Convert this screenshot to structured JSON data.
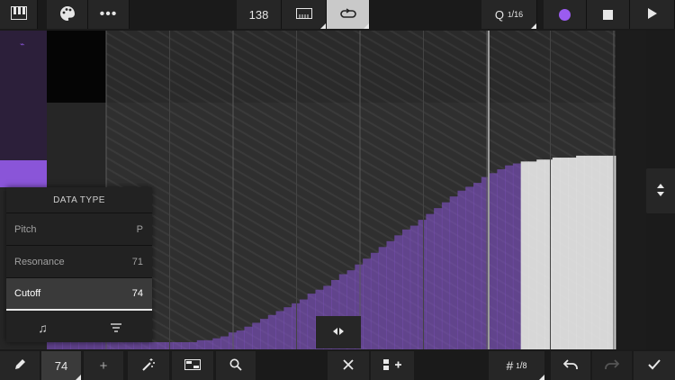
{
  "toolbar": {
    "tempo": "138",
    "quantize_q": "Q",
    "quantize_num": "1",
    "quantize_den": "16"
  },
  "colors": {
    "accent": "#8a55d8",
    "record": "#9b5cf0",
    "ghost_fill": "#e0e0e0"
  },
  "panel": {
    "title": "DATA TYPE",
    "items": [
      {
        "label": "Pitch",
        "value": "P"
      },
      {
        "label": "Resonance",
        "value": "71"
      },
      {
        "label": "Cutoff",
        "value": "74"
      }
    ],
    "selected": "Cutoff"
  },
  "bottom": {
    "cc_value": "74",
    "add_symbol": "+",
    "grid_symbol": "#",
    "grid_num": "1",
    "grid_den": "8"
  },
  "chart_data": {
    "type": "bar",
    "steps": [
      8,
      8,
      8,
      8,
      7,
      6,
      5,
      4,
      3,
      2,
      2,
      1,
      1,
      0,
      0,
      0,
      0,
      0,
      0,
      1,
      1,
      2,
      3,
      5,
      6,
      8,
      10,
      12,
      14,
      16,
      18,
      20,
      22,
      25,
      27,
      29,
      32,
      35,
      37,
      40,
      43,
      46,
      49,
      52,
      55,
      58,
      60,
      63,
      66,
      69,
      72,
      75,
      78,
      80,
      82,
      85,
      87,
      89,
      91,
      92,
      93,
      93,
      94,
      94,
      95,
      95,
      95,
      96,
      96,
      96,
      96,
      96
    ],
    "ylim": [
      0,
      127
    ]
  }
}
